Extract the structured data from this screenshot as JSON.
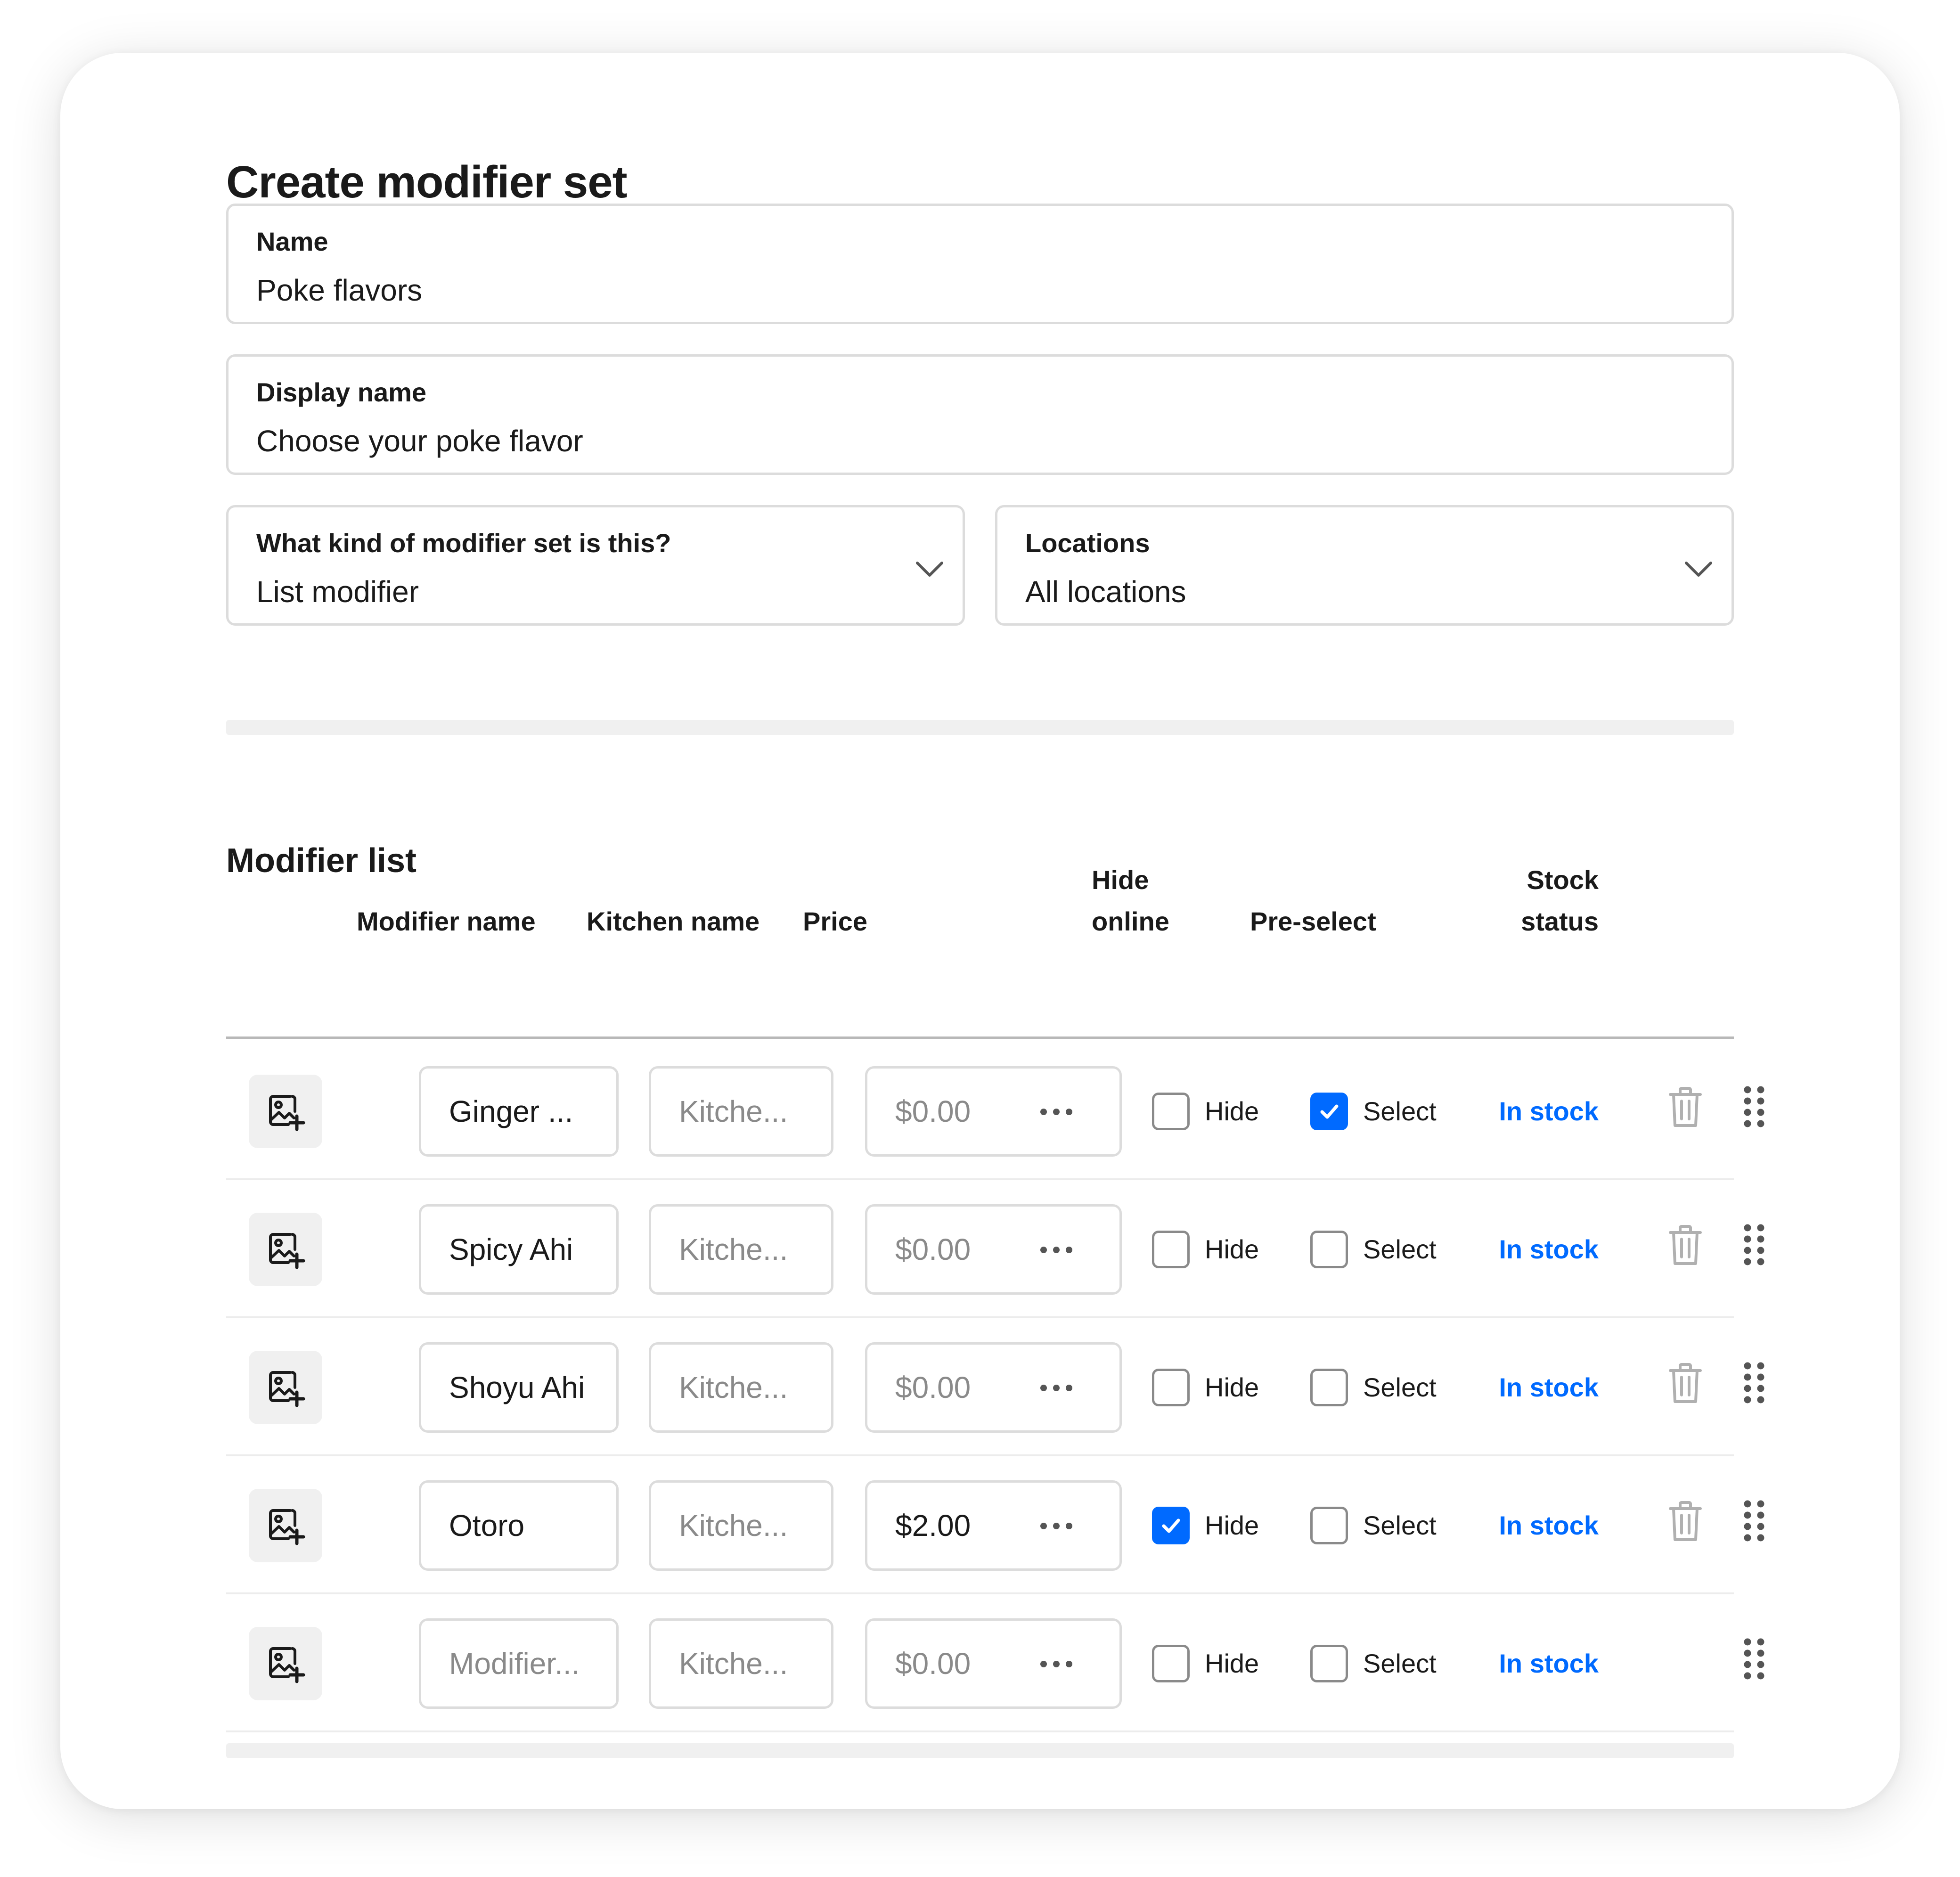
{
  "page": {
    "title": "Create modifier set"
  },
  "form": {
    "name": {
      "label": "Name",
      "value": "Poke flavors"
    },
    "display_name": {
      "label": "Display name",
      "value": "Choose your poke flavor"
    },
    "kind": {
      "label": "What kind of modifier set is this?",
      "value": "List modifier"
    },
    "locations": {
      "label": "Locations",
      "value": "All locations"
    }
  },
  "modifier_list": {
    "title": "Modifier list",
    "columns": {
      "modifier_name": "Modifier name",
      "kitchen_name": "Kitchen name",
      "price": "Price",
      "hide_online_1": "Hide",
      "hide_online_2": "online",
      "pre_select": "Pre-select",
      "stock_status_1": "Stock",
      "stock_status_2": "status"
    },
    "rows": [
      {
        "name": "Ginger ...",
        "name_placeholder": false,
        "kitchen": "Kitche...",
        "price": "$0.00",
        "price_placeholder": true,
        "hide_label": "Hide",
        "hide": false,
        "select_label": "Select",
        "select": true,
        "stock": "In stock",
        "deletable": true
      },
      {
        "name": "Spicy Ahi",
        "name_placeholder": false,
        "kitchen": "Kitche...",
        "price": "$0.00",
        "price_placeholder": true,
        "hide_label": "Hide",
        "hide": false,
        "select_label": "Select",
        "select": false,
        "stock": "In stock",
        "deletable": true
      },
      {
        "name": "Shoyu Ahi",
        "name_placeholder": false,
        "kitchen": "Kitche...",
        "price": "$0.00",
        "price_placeholder": true,
        "hide_label": "Hide",
        "hide": false,
        "select_label": "Select",
        "select": false,
        "stock": "In stock",
        "deletable": true
      },
      {
        "name": "Otoro",
        "name_placeholder": false,
        "kitchen": "Kitche...",
        "price": "$2.00",
        "price_placeholder": false,
        "hide_label": "Hide",
        "hide": true,
        "select_label": "Select",
        "select": false,
        "stock": "In stock",
        "deletable": true
      },
      {
        "name": "Modifier...",
        "name_placeholder": true,
        "kitchen": "Kitche...",
        "price": "$0.00",
        "price_placeholder": true,
        "hide_label": "Hide",
        "hide": false,
        "select_label": "Select",
        "select": false,
        "stock": "In stock",
        "deletable": false
      }
    ]
  },
  "icons": {
    "row_image": "add-image-icon",
    "price_menu": "more-horizontal-icon",
    "delete": "trash-icon",
    "reorder": "drag-handle-icon",
    "dropdown": "chevron-down-icon",
    "checkbox": "check-icon"
  },
  "colors": {
    "accent": "#006aff",
    "border": "#dcdcdc",
    "divider": "#f0f0f0",
    "text": "#1a1a1a",
    "placeholder": "#8a8a8a",
    "icon_muted": "#b0b0b0"
  }
}
